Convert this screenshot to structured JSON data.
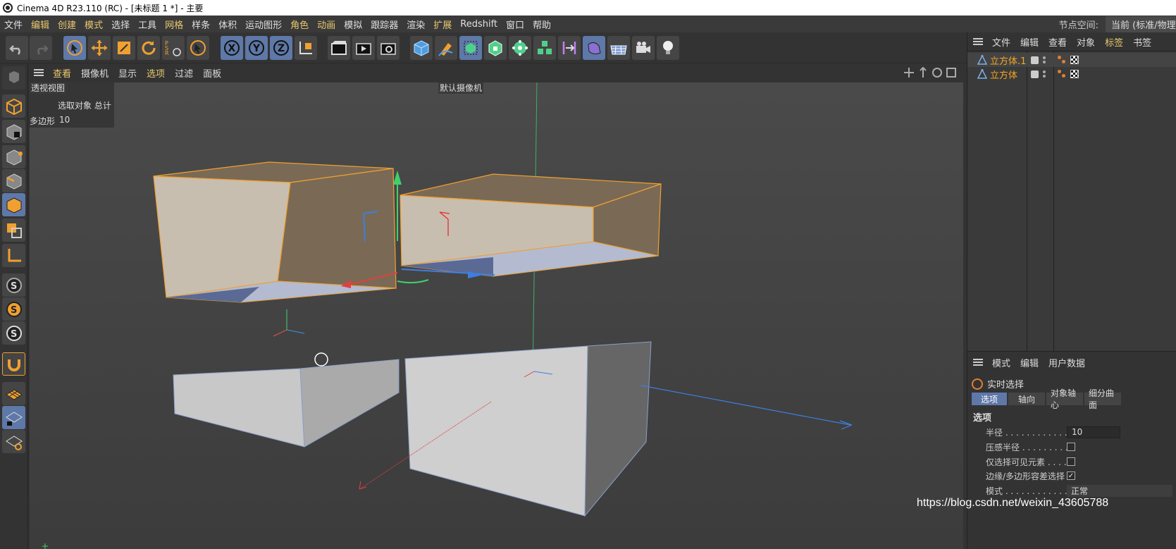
{
  "window": {
    "title": "Cinema 4D R23.110 (RC) - [未标题 1 *] - 主要"
  },
  "menubar": {
    "items": [
      "文件",
      "编辑",
      "创建",
      "模式",
      "选择",
      "工具",
      "网格",
      "样条",
      "体积",
      "运动图形",
      "角色",
      "动画",
      "模拟",
      "跟踪器",
      "渲染",
      "扩展",
      "Redshift",
      "窗口",
      "帮助"
    ],
    "node_space_label": "节点空间:",
    "node_space_value": "当前 (标准/物理)"
  },
  "toolbar": {
    "icons": [
      "undo-icon",
      "redo-icon",
      "live-select-icon",
      "move-icon",
      "scale-icon",
      "rotate-icon",
      "psr-icon",
      "recent-tool-icon",
      "x-axis-icon",
      "y-axis-icon",
      "z-axis-icon",
      "coordinate-system-icon",
      "render-region-icon",
      "render-view-icon",
      "render-settings-icon",
      "cube-icon",
      "pen-icon",
      "subdivision-icon",
      "extrude-icon",
      "cloner-icon",
      "array-icon",
      "symmetry-icon",
      "deformer-icon",
      "floor-icon",
      "camera-icon",
      "light-icon"
    ]
  },
  "viewport_menu": {
    "items": [
      "查看",
      "摄像机",
      "显示",
      "选项",
      "过滤",
      "面板"
    ]
  },
  "viewport": {
    "view_name": "透视视图",
    "camera_name": "默认摄像机",
    "hud_header": "选取对象 总计",
    "hud_label": "多边形",
    "hud_value": "10"
  },
  "objects_panel": {
    "menu": [
      "文件",
      "编辑",
      "查看",
      "对象",
      "标签",
      "书签"
    ],
    "objects": [
      {
        "name": "立方体.1"
      },
      {
        "name": "立方体"
      }
    ]
  },
  "attributes_panel": {
    "menu": [
      "模式",
      "编辑",
      "用户数据"
    ],
    "tool_name": "实时选择",
    "tabs": [
      "选项",
      "轴向",
      "对象轴心",
      "细分曲面"
    ],
    "section": "选项",
    "radius_label": "半径 . . . . . . . . . . . .",
    "radius_value": "10",
    "pressure_label": "压感半径 . . . . . . . . .",
    "visible_only_label": "仅选择可见元素 . . . .",
    "edge_poly_label": "边缘/多边形容差选择",
    "mode_label": "模式 . . . . . . . . . . . .",
    "mode_value": "正常"
  },
  "watermark": "https://blog.csdn.net/weixin_43605788",
  "colors": {
    "accent": "#5e78a8",
    "selection": "#f5a623",
    "viewport_bg": "#4b4b4b"
  }
}
